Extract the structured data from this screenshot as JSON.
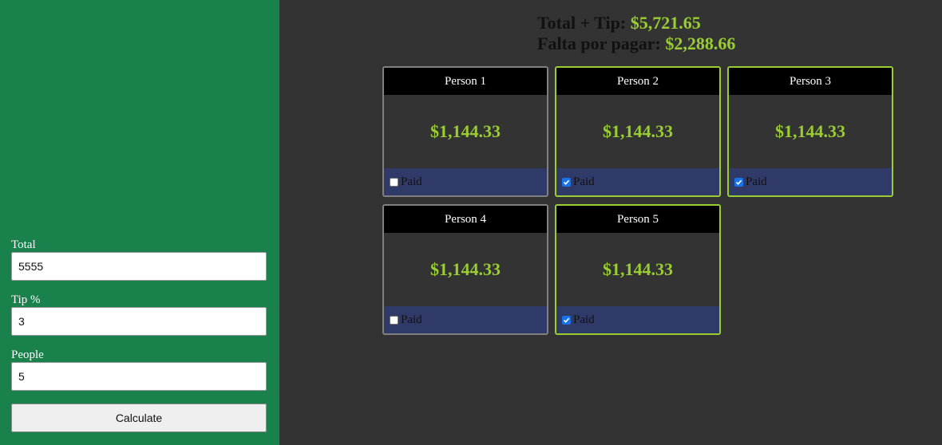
{
  "form": {
    "total_label": "Total",
    "total_value": "5555",
    "tip_label": "Tip %",
    "tip_value": "3",
    "people_label": "People",
    "people_value": "5",
    "calculate_label": "Calculate"
  },
  "summary": {
    "total_tip_label": "Total + Tip:",
    "total_tip_value": "$5,721.65",
    "remaining_label": "Falta por pagar:",
    "remaining_value": "$2,288.66"
  },
  "people": [
    {
      "name": "Person 1",
      "amount": "$1,144.33",
      "paid_label": "Paid",
      "paid": false
    },
    {
      "name": "Person 2",
      "amount": "$1,144.33",
      "paid_label": "Paid",
      "paid": true
    },
    {
      "name": "Person 3",
      "amount": "$1,144.33",
      "paid_label": "Paid",
      "paid": true
    },
    {
      "name": "Person 4",
      "amount": "$1,144.33",
      "paid_label": "Paid",
      "paid": false
    },
    {
      "name": "Person 5",
      "amount": "$1,144.33",
      "paid_label": "Paid",
      "paid": true
    }
  ],
  "colors": {
    "sidebar": "#18814c",
    "main_bg": "#333333",
    "accent": "#9acd32",
    "card_footer": "#303a68",
    "unpaid_border": "#808080"
  }
}
